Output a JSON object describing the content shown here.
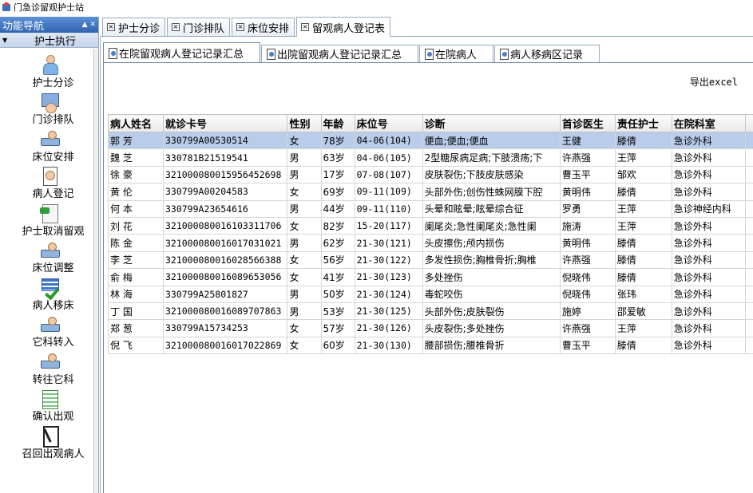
{
  "window": {
    "title": "门急诊留观护士站"
  },
  "sidebar": {
    "header": "功能导航",
    "header_controls": "▲ ✕",
    "section": "护士执行",
    "items": [
      {
        "label": "护士分诊",
        "icon": "nurse-icon"
      },
      {
        "label": "门诊排队",
        "icon": "queue-icon"
      },
      {
        "label": "床位安排",
        "icon": "bed-arrange-icon"
      },
      {
        "label": "病人登记",
        "icon": "patient-register-icon"
      },
      {
        "label": "护士取消留观",
        "icon": "cancel-observation-icon"
      },
      {
        "label": "床位调整",
        "icon": "bed-adjust-icon"
      },
      {
        "label": "病人移床",
        "icon": "patient-move-icon"
      },
      {
        "label": "它科转入",
        "icon": "transfer-in-icon"
      },
      {
        "label": "转往它科",
        "icon": "transfer-out-icon"
      },
      {
        "label": "确认出观",
        "icon": "confirm-discharge-icon"
      },
      {
        "label": "召回出观病人",
        "icon": "recall-patient-icon"
      }
    ]
  },
  "top_tabs": [
    {
      "label": "护士分诊"
    },
    {
      "label": "门诊排队"
    },
    {
      "label": "床位安排"
    },
    {
      "label": "留观病人登记表",
      "active": true
    }
  ],
  "sub_tabs": [
    {
      "label": "在院留观病人登记记录汇总",
      "active": true
    },
    {
      "label": "出院留观病人登记记录汇总"
    },
    {
      "label": "在院病人"
    },
    {
      "label": "病人移病区记录"
    }
  ],
  "export_label": "导出excel",
  "table": {
    "columns": [
      "病人姓名",
      "就诊卡号",
      "性别",
      "年龄",
      "床位号",
      "诊断",
      "首诊医生",
      "责任护士",
      "在院科室"
    ],
    "rows": [
      [
        "郭 芳",
        "330799A00530514",
        "女",
        "78岁",
        "04-06(104)",
        "便血;便血;便血",
        "王健",
        "滕倩",
        "急诊外科"
      ],
      [
        "魏 芝",
        "330781B21519541",
        "男",
        "63岁",
        "04-06(105)",
        "2型糖尿病足病;下肢溃疡;下",
        "许燕强",
        "王萍",
        "急诊外科"
      ],
      [
        "徐 豪",
        "321000080015956452698",
        "男",
        "17岁",
        "07-08(107)",
        "皮肤裂伤;下肢皮肤感染",
        "曹玉平",
        "邹欢",
        "急诊外科"
      ],
      [
        "黄 伦",
        "330799A00204583",
        "女",
        "69岁",
        "09-11(109)",
        "头部外伤;创伤性蛛网膜下腔",
        "黄明伟",
        "滕倩",
        "急诊外科"
      ],
      [
        "何 本",
        "330799A23654616",
        "男",
        "44岁",
        "09-11(110)",
        "头晕和眩晕;眩晕综合征",
        "罗勇",
        "王萍",
        "急诊神经内科"
      ],
      [
        "刘 花",
        "321000080016103311706",
        "女",
        "82岁",
        "15-20(117)",
        "阑尾炎;急性阑尾炎;急性阑",
        "施涛",
        "王萍",
        "急诊外科"
      ],
      [
        "陈 金",
        "321000080016017031021",
        "男",
        "62岁",
        "21-30(121)",
        "头皮擦伤;颅内损伤",
        "黄明伟",
        "滕倩",
        "急诊外科"
      ],
      [
        "李 芝",
        "321000080016028566388",
        "女",
        "56岁",
        "21-30(122)",
        "多发性损伤;胸椎骨折;胸椎",
        "许燕强",
        "滕倩",
        "急诊外科"
      ],
      [
        "俞 梅",
        "321000080016089653056",
        "女",
        "41岁",
        "21-30(123)",
        "多处挫伤",
        "倪晓伟",
        "滕倩",
        "急诊外科"
      ],
      [
        "林 海",
        "330799A25801827",
        "男",
        "50岁",
        "21-30(124)",
        "毒蛇咬伤",
        "倪晓伟",
        "张玮",
        "急诊外科"
      ],
      [
        "丁 国",
        "321000080016089707863",
        "男",
        "53岁",
        "21-30(125)",
        "头部外伤;皮肤裂伤",
        "施婷",
        "邵爱敏",
        "急诊外科"
      ],
      [
        "郑 葱",
        "330799A15734253",
        "女",
        "57岁",
        "21-30(126)",
        "头皮裂伤;多处挫伤",
        "许燕强",
        "王萍",
        "急诊外科"
      ],
      [
        "倪 飞",
        "321000080016017022869",
        "女",
        "60岁",
        "21-30(130)",
        "腰部损伤;腰椎骨折",
        "曹玉平",
        "滕倩",
        "急诊外科"
      ]
    ],
    "selected_row": 0
  },
  "colors": {
    "selected_row": "#b9cdea",
    "header_blue": "#2f63ad"
  }
}
